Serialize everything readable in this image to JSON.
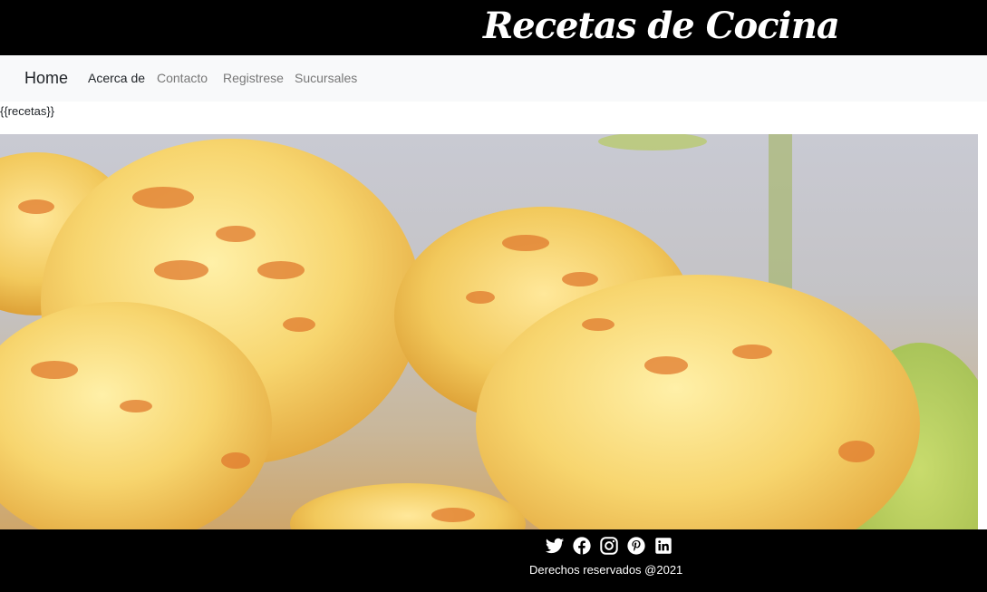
{
  "header": {
    "brand": "Recetas de Cocina"
  },
  "navbar": {
    "brand": "Home",
    "links": [
      {
        "label": "Acerca de",
        "active": true
      },
      {
        "label": "Contacto",
        "active": false
      },
      {
        "label": "Registrese",
        "active": false
      },
      {
        "label": "Sucursales",
        "active": false
      }
    ]
  },
  "main": {
    "template_placeholder": "{{recetas}}",
    "hero_image": "cheese-bread-photo"
  },
  "footer": {
    "social_icons": [
      "twitter-icon",
      "facebook-icon",
      "instagram-icon",
      "pinterest-icon",
      "linkedin-icon"
    ],
    "copyright": "Derechos reservados @2021"
  },
  "colors": {
    "header_bg": "#000000",
    "navbar_bg": "#f8f9fa",
    "footer_bg": "#000000",
    "text_light": "#ffffff"
  }
}
